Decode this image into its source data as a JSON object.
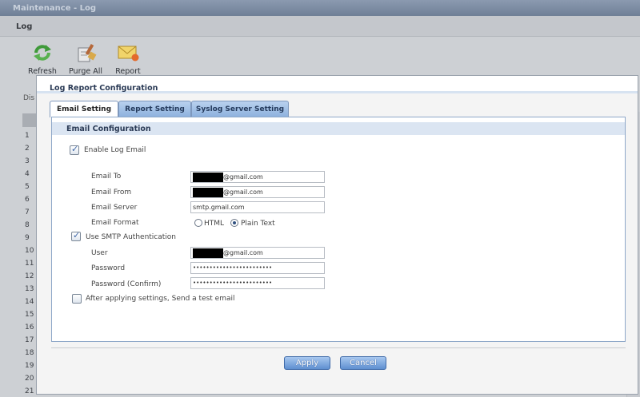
{
  "window": {
    "title": "Maintenance - Log"
  },
  "page": {
    "header": "Log",
    "partial_label": "Dis"
  },
  "toolbar": {
    "refresh_label": "Refresh",
    "purge_label": "Purge All",
    "report_label": "Report"
  },
  "background_rows": [
    "1",
    "2",
    "3",
    "4",
    "5",
    "6",
    "7",
    "8",
    "9",
    "10",
    "11",
    "12",
    "13",
    "14",
    "15",
    "16",
    "17",
    "18",
    "19",
    "20",
    "21"
  ],
  "dialog": {
    "title": "Log Report Configuration",
    "tabs": [
      {
        "label": "Email Setting",
        "active": true
      },
      {
        "label": "Report Setting",
        "active": false
      },
      {
        "label": "Syslog Server Setting",
        "active": false
      }
    ],
    "section_title": "Email Configuration",
    "enable_log_email": {
      "label": "Enable Log Email",
      "checked": true
    },
    "fields": {
      "email_to": {
        "label": "Email To",
        "value": "@gmail.com"
      },
      "email_from": {
        "label": "Email From",
        "value": "@gmail.com"
      },
      "email_server": {
        "label": "Email Server",
        "value": "smtp.gmail.com"
      },
      "email_format": {
        "label": "Email Format",
        "options": [
          "HTML",
          "Plain Text"
        ],
        "selected": "Plain Text"
      }
    },
    "smtp_auth": {
      "label": "Use SMTP Authentication",
      "checked": true
    },
    "auth": {
      "user": {
        "label": "User",
        "value": "@gmail.com"
      },
      "password": {
        "label": "Password",
        "value": "••••••••••••••••••••••••"
      },
      "password_confirm": {
        "label": "Password (Confirm)",
        "value": "••••••••••••••••••••••••"
      }
    },
    "test_email": {
      "label": "After applying settings, Send a test email",
      "checked": false
    },
    "buttons": {
      "apply": "Apply",
      "cancel": "Cancel"
    }
  },
  "colors": {
    "accent": "#5f8fd0",
    "tab_inactive": "#8eb2de",
    "section_bg": "#dbe5f2"
  }
}
